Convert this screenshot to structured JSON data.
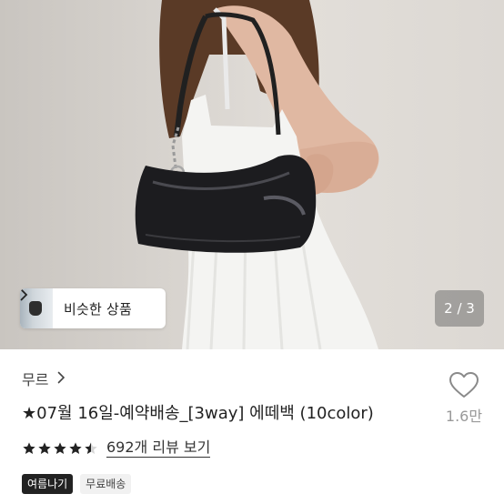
{
  "hero": {
    "similar_products_label": "비슷한 상품",
    "page_indicator": "2 / 3",
    "colors": {
      "background": "#d8d4cf",
      "dress": "#f4f4f2",
      "hair": "#5a3a26",
      "bag": "#1c1c1f"
    }
  },
  "store": {
    "name": "무르"
  },
  "product": {
    "title": "★07월 16일-예약배송_[3way] 에떼백 (10color)",
    "like_count": "1.6만",
    "rating": 4.5,
    "review_link": "692개 리뷰 보기"
  },
  "tags": [
    "여름나기",
    "무료배송"
  ],
  "icons": {
    "similar_chevron": "chevron-right-icon",
    "store_chevron": "chevron-right-icon",
    "like": "heart-outline-icon",
    "star": "star-icon"
  }
}
